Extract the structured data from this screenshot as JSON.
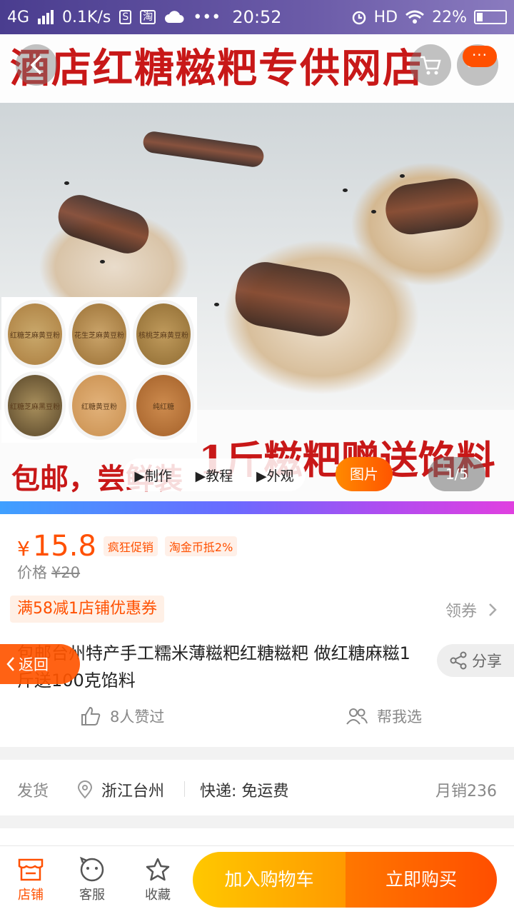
{
  "status_bar": {
    "network": "4G",
    "speed": "0.1K/s",
    "time": "20:52",
    "hd": "HD",
    "battery": "22%"
  },
  "hero": {
    "banner_top": "酒店红糖糍粑专供网店",
    "banner_bottom_left": "包邮，尝鲜装",
    "banner_bottom_right": "1斤糍粑赠送馅料",
    "thumbs": [
      "红糖芝麻黄豆粉",
      "花生芝麻黄豆粉",
      "核桃芝麻黄豆粉",
      "红糖芝麻黑豆粉",
      "红糖黄豆粉",
      "纯红糖"
    ],
    "more_label": "···",
    "video_tabs": [
      "▶制作",
      "▶教程",
      "▶外观"
    ],
    "pic_button": "图片",
    "page_indicator": "1/5"
  },
  "price": {
    "currency": "¥",
    "current": "15.8",
    "tags": [
      "疯狂促销",
      "淘金币抵2%"
    ],
    "orig_label": "价格",
    "orig_value": "¥20"
  },
  "coupon": {
    "text": "满58减1店铺优惠券",
    "action": "领券"
  },
  "product": {
    "title": "包邮台州特产手工糯米薄糍粑红糖糍粑 做红糖麻糍1斤送100克馅料",
    "share": "分享",
    "back": "返回",
    "likes": "8人赞过",
    "help_choose": "帮我选"
  },
  "shipping": {
    "label": "发货",
    "location": "浙江台州",
    "express": "快递: 免运费",
    "monthly_sales": "月销236"
  },
  "bottom_bar": {
    "shop": "店铺",
    "service": "客服",
    "favorite": "收藏",
    "add_cart": "加入购物车",
    "buy_now": "立即购买"
  },
  "colors": {
    "accent": "#ff5000",
    "banner_red": "#c81818"
  }
}
